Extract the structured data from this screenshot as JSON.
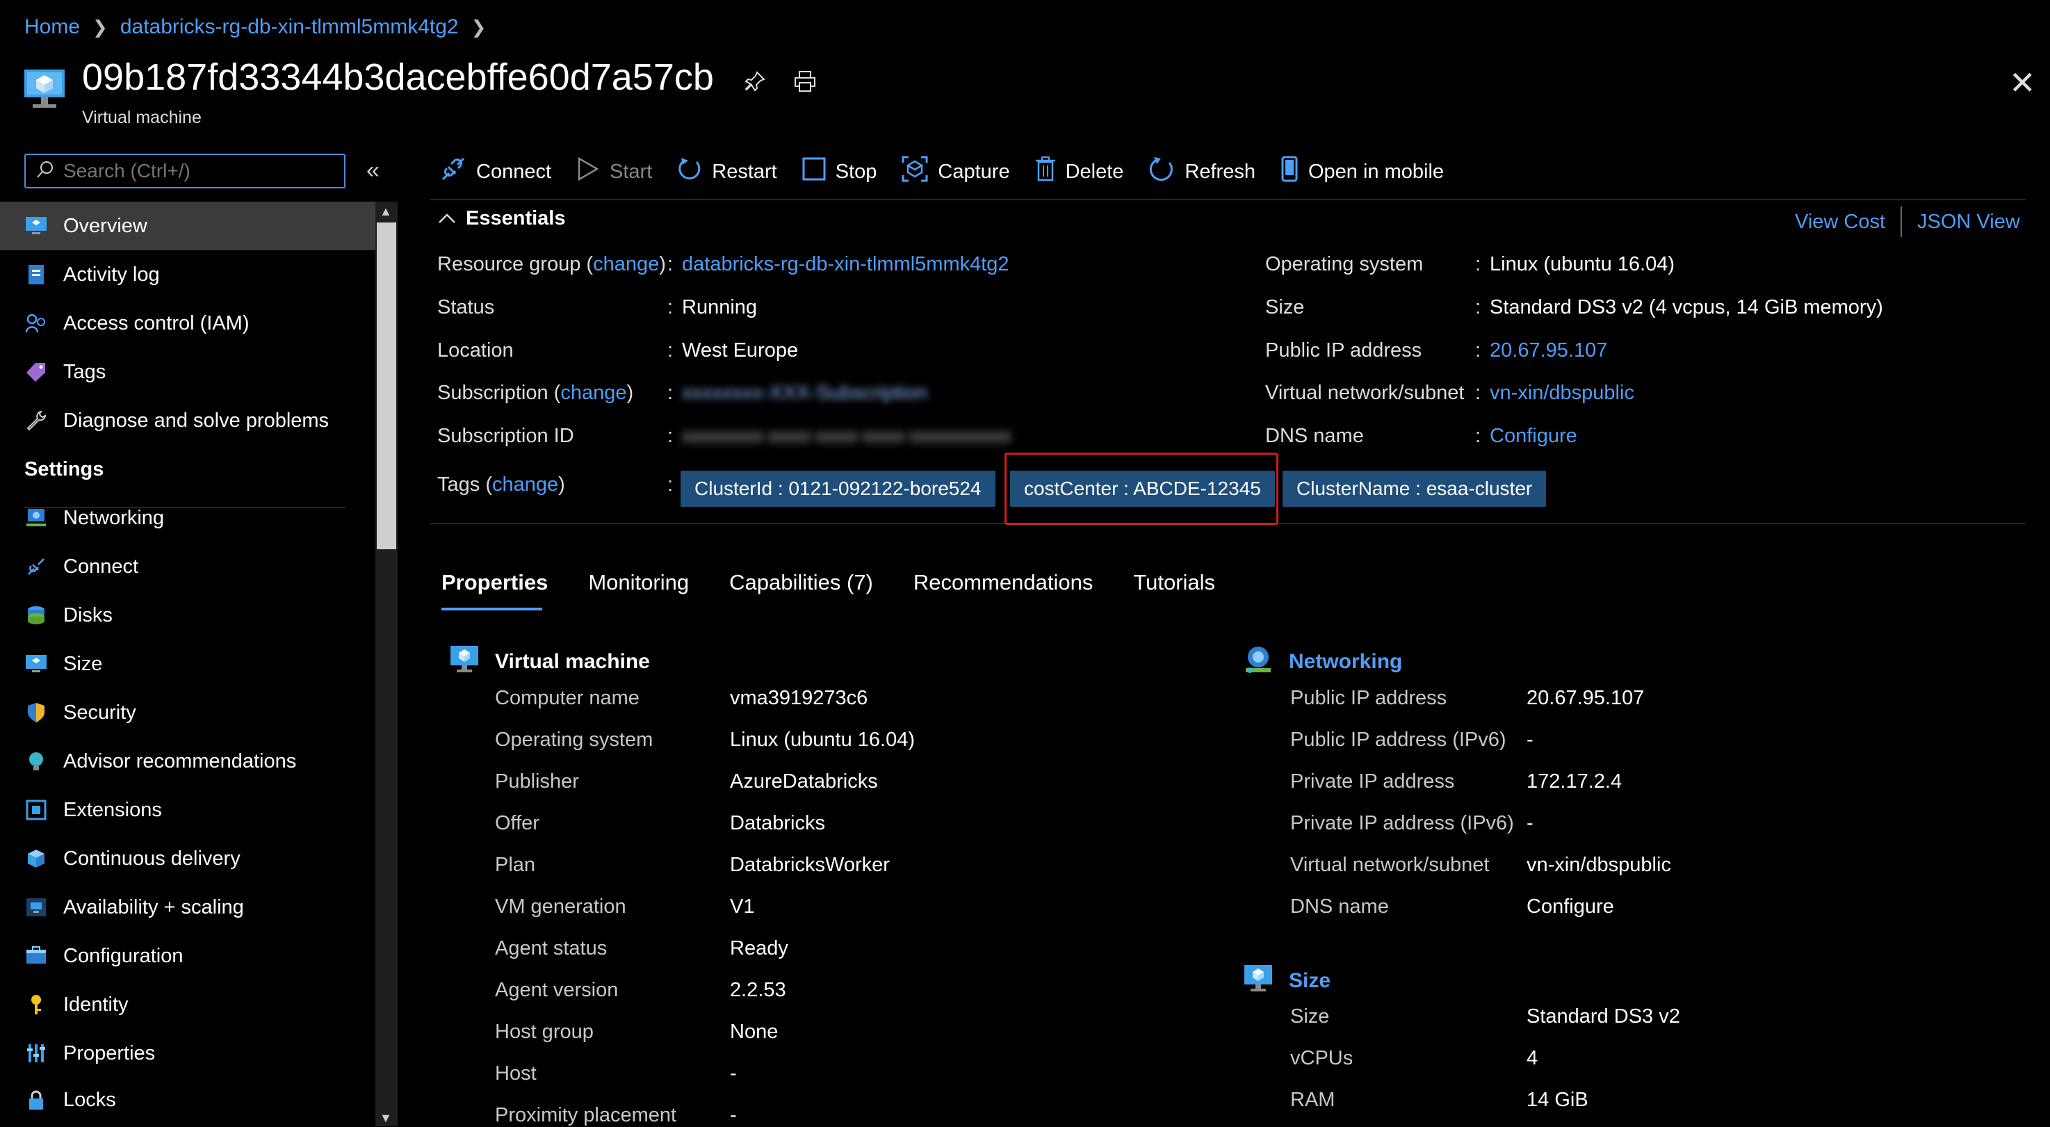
{
  "breadcrumb": {
    "home": "Home",
    "resource_group": "databricks-rg-db-xin-tlmml5mmk4tg2"
  },
  "header": {
    "title": "09b187fd33344b3dacebffe60d7a57cb",
    "subtitle": "Virtual machine"
  },
  "search": {
    "placeholder": "Search (Ctrl+/)"
  },
  "sidebar": {
    "items": [
      {
        "label": "Overview",
        "icon": "vm-icon",
        "active": true
      },
      {
        "label": "Activity log",
        "icon": "activity-log-icon"
      },
      {
        "label": "Access control (IAM)",
        "icon": "iam-icon"
      },
      {
        "label": "Tags",
        "icon": "tag-icon"
      },
      {
        "label": "Diagnose and solve problems",
        "icon": "wrench-icon"
      }
    ],
    "settings_label": "Settings",
    "settings_items": [
      {
        "label": "Networking",
        "icon": "networking-icon"
      },
      {
        "label": "Connect",
        "icon": "connect-icon"
      },
      {
        "label": "Disks",
        "icon": "disks-icon"
      },
      {
        "label": "Size",
        "icon": "size-icon"
      },
      {
        "label": "Security",
        "icon": "shield-icon"
      },
      {
        "label": "Advisor recommendations",
        "icon": "advisor-icon"
      },
      {
        "label": "Extensions",
        "icon": "extensions-icon"
      },
      {
        "label": "Continuous delivery",
        "icon": "delivery-icon"
      },
      {
        "label": "Availability + scaling",
        "icon": "scaling-icon"
      },
      {
        "label": "Configuration",
        "icon": "configuration-icon"
      },
      {
        "label": "Identity",
        "icon": "identity-icon"
      },
      {
        "label": "Properties",
        "icon": "properties-icon"
      },
      {
        "label": "Locks",
        "icon": "lock-icon"
      }
    ]
  },
  "toolbar": {
    "connect": "Connect",
    "start": "Start",
    "restart": "Restart",
    "stop": "Stop",
    "capture": "Capture",
    "delete": "Delete",
    "refresh": "Refresh",
    "open_mobile": "Open in mobile"
  },
  "essentials": {
    "title": "Essentials",
    "view_cost": "View Cost",
    "json_view": "JSON View",
    "change": "change",
    "left": {
      "resource_group_label": "Resource group",
      "resource_group_value": "databricks-rg-db-xin-tlmml5mmk4tg2",
      "status_label": "Status",
      "status_value": "Running",
      "location_label": "Location",
      "location_value": "West Europe",
      "subscription_label": "Subscription",
      "subscription_value": "xxxxxxxx-XXX-Subscription",
      "subscription_id_label": "Subscription ID",
      "subscription_id_value": "xxxxxxxx-xxxx-xxxx-xxxx-xxxxxxxxxx",
      "tags_label": "Tags"
    },
    "right": {
      "os_label": "Operating system",
      "os_value": "Linux (ubuntu 16.04)",
      "size_label": "Size",
      "size_value": "Standard DS3 v2 (4 vcpus, 14 GiB memory)",
      "public_ip_label": "Public IP address",
      "public_ip_value": "20.67.95.107",
      "vnet_label": "Virtual network/subnet",
      "vnet_value": "vn-xin/dbspublic",
      "dns_label": "DNS name",
      "dns_value": "Configure"
    },
    "tags": [
      "ClusterId : 0121-092122-bore524",
      "costCenter : ABCDE-12345",
      "ClusterName : esaa-cluster"
    ]
  },
  "tabs": [
    "Properties",
    "Monitoring",
    "Capabilities (7)",
    "Recommendations",
    "Tutorials"
  ],
  "vm_section": {
    "title": "Virtual machine",
    "rows": [
      {
        "label": "Computer name",
        "value": "vma3919273c6"
      },
      {
        "label": "Operating system",
        "value": "Linux (ubuntu 16.04)"
      },
      {
        "label": "Publisher",
        "value": "AzureDatabricks"
      },
      {
        "label": "Offer",
        "value": "Databricks"
      },
      {
        "label": "Plan",
        "value": "DatabricksWorker"
      },
      {
        "label": "VM generation",
        "value": "V1"
      },
      {
        "label": "Agent status",
        "value": "Ready"
      },
      {
        "label": "Agent version",
        "value": "2.2.53"
      },
      {
        "label": "Host group",
        "value": "None"
      },
      {
        "label": "Host",
        "value": "-"
      },
      {
        "label": "Proximity placement",
        "value": "-"
      }
    ]
  },
  "networking_section": {
    "title": "Networking",
    "rows": [
      {
        "label": "Public IP address",
        "value": "20.67.95.107"
      },
      {
        "label": "Public IP address (IPv6)",
        "value": "-"
      },
      {
        "label": "Private IP address",
        "value": "172.17.2.4"
      },
      {
        "label": "Private IP address (IPv6)",
        "value": "-"
      },
      {
        "label": "Virtual network/subnet",
        "value": "vn-xin/dbspublic"
      },
      {
        "label": "DNS name",
        "value": "Configure"
      }
    ]
  },
  "size_section": {
    "title": "Size",
    "rows": [
      {
        "label": "Size",
        "value": "Standard DS3 v2"
      },
      {
        "label": "vCPUs",
        "value": "4"
      },
      {
        "label": "RAM",
        "value": "14 GiB"
      }
    ]
  },
  "colors": {
    "link": "#4f9ef8",
    "tag_bg": "#1e4e79",
    "highlight": "#d01b1b",
    "active_nav": "#3b3b3b"
  }
}
